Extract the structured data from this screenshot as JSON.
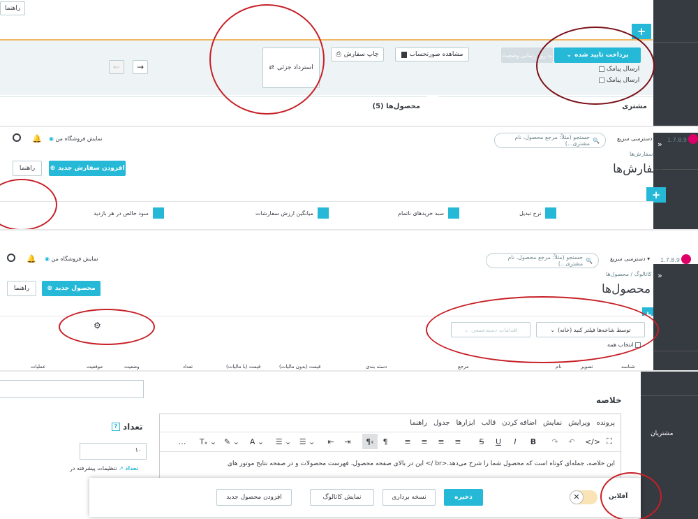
{
  "panel1": {
    "help_button": "راهنما",
    "status_dropdown": "پرداخت تایید شده",
    "update_status_button": "به روز رسانی وضعیت",
    "send_sms_1": "ارسال پیامک",
    "send_sms_2": "ارسال پیامک",
    "print_order_button": "چاپ سفارش",
    "view_invoice_button": "مشاهده صورتحساب",
    "partial_refund_button": "استرداد جزئی",
    "products_tab": "محصول‌ها (5)",
    "customer_tab": "مشتری"
  },
  "panel2": {
    "version": "1.7.8.9",
    "quick_access": "دسترسی سریع",
    "search_placeholder": "جستجو (مثلاً: مرجع محصول، نام مشتری...)",
    "view_shop": "نمایش فروشگاه من",
    "breadcrumb": "سفارش‌ها",
    "page_title": "سفارش‌ها",
    "add_order_button": "افزودن سفارش جدید",
    "help_button": "راهنما",
    "kpi": [
      "نرخ تبدیل",
      "سبد خریدهای ناتمام",
      "میانگین ارزش سفارشات",
      "سود خالص در هر بازدید"
    ]
  },
  "panel3": {
    "version": "1.7.8.9",
    "quick_access": "دسترسی سریع",
    "search_placeholder": "جستجو (مثلاً: مرجع محصول، نام مشتری...)",
    "view_shop": "نمایش فروشگاه من",
    "breadcrumb": "کاتالوگ / محصول‌ها",
    "page_title": "محصول‌ها",
    "new_product_button": "محصول جدید",
    "help_button": "راهنما",
    "filter_category": "توسط شاخه‌ها فیلتر کنید (خانه)",
    "bulk_actions": "اقدامات دسته‌جمعی",
    "select_all": "انتخاب همه",
    "columns": [
      "شناسه",
      "تصویر",
      "نام",
      "مرجع",
      "دسته بندی",
      "قیمت (بدون مالیات)",
      "قیمت (با مالیات)",
      "تعداد",
      "وضعیت",
      "موقعیت",
      "عملیات"
    ]
  },
  "panel4": {
    "side_item": "مشتریان",
    "summary_label": "خلاصه",
    "menu": [
      "پرونده",
      "ویرایش",
      "نمایش",
      "اضافه کردن",
      "قالب",
      "ابزارها",
      "جدول",
      "راهنما"
    ],
    "editor_text_1": "این خلاصه، جمله‌ای کوتاه است که محصول شما را شرح می‌دهد.<br /> این در بالای صفحه محصول، فهرست محصولات و در صفحه نتایج موتور های",
    "quantity_title": "تعداد",
    "quantity_value": "۱۰",
    "advanced_settings": "تنظیمات پیشرفته در",
    "quantity_link": "تعداد",
    "offline_label": "آفلاین",
    "save_button": "ذخیره",
    "duplicate_button": "نسخه برداری",
    "catalog_button": "نمایش کاتالوگ",
    "add_product_button": "افزودن محصول جدید"
  },
  "colors": {
    "accent": "#25b9d7",
    "dark": "#363a41",
    "ring": "#c62026"
  }
}
